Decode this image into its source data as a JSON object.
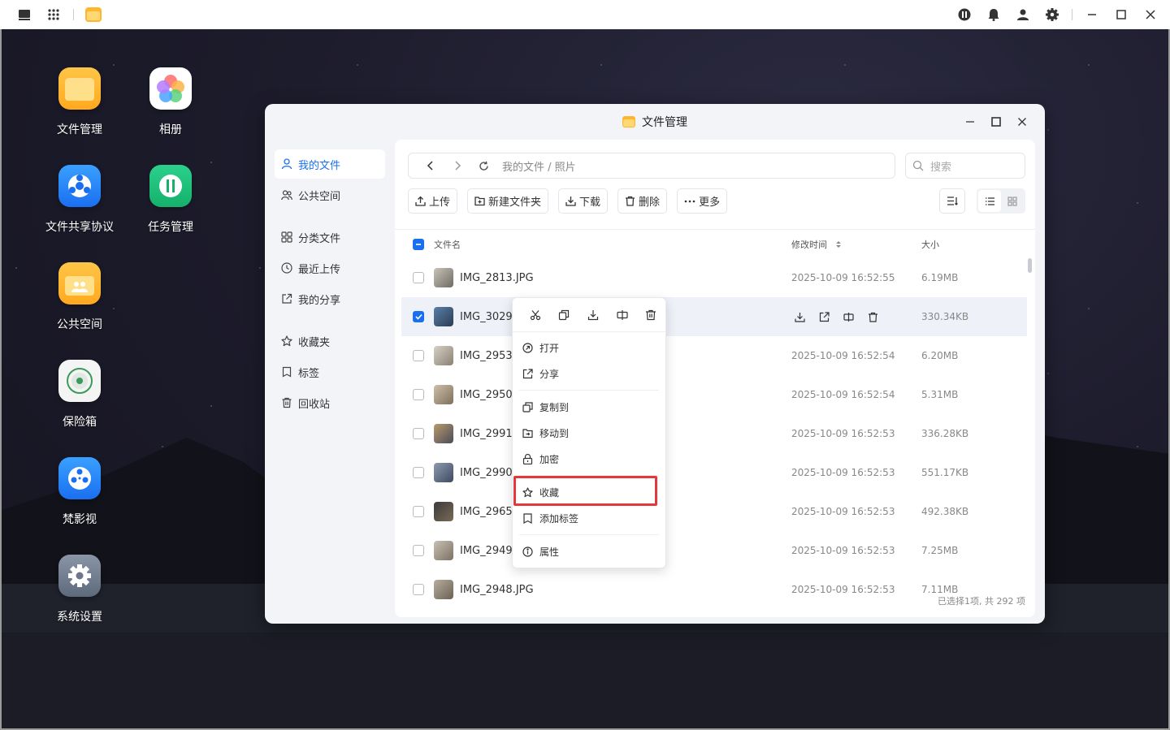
{
  "desktop": {
    "apps": [
      {
        "name": "file-manager",
        "label": "文件管理"
      },
      {
        "name": "photos",
        "label": "相册"
      },
      {
        "name": "file-sharing-protocol",
        "label": "文件共享协议"
      },
      {
        "name": "task-manager",
        "label": "任务管理"
      },
      {
        "name": "public-space",
        "label": "公共空间"
      },
      {
        "name": "safe-box",
        "label": "保险箱"
      },
      {
        "name": "video",
        "label": "梵影视"
      },
      {
        "name": "system-settings",
        "label": "系统设置"
      }
    ]
  },
  "window": {
    "title": "文件管理",
    "sidebar": {
      "items": [
        {
          "label": "我的文件",
          "icon": "person-icon",
          "active": true
        },
        {
          "label": "公共空间",
          "icon": "people-icon"
        },
        {
          "label": "分类文件",
          "icon": "grid-icon"
        },
        {
          "label": "最近上传",
          "icon": "clock-icon"
        },
        {
          "label": "我的分享",
          "icon": "share-icon"
        },
        {
          "label": "收藏夹",
          "icon": "star-icon"
        },
        {
          "label": "标签",
          "icon": "tag-icon"
        },
        {
          "label": "回收站",
          "icon": "trash-icon"
        }
      ]
    },
    "address": {
      "path": "我的文件 / 照片"
    },
    "search": {
      "placeholder": "搜索"
    },
    "toolbar": {
      "upload": "上传",
      "new_folder": "新建文件夹",
      "download": "下载",
      "delete": "删除",
      "more": "更多"
    },
    "table": {
      "col_name": "文件名",
      "col_time": "修改时间",
      "col_size": "大小",
      "rows": [
        {
          "name": "IMG_2813.JPG",
          "time": "2025-10-09 16:52:55",
          "size": "6.19MB",
          "checked": false
        },
        {
          "name": "IMG_3029.",
          "time": "",
          "size": "330.34KB",
          "checked": true
        },
        {
          "name": "IMG_2953.",
          "time": "2025-10-09 16:52:54",
          "size": "6.20MB",
          "checked": false
        },
        {
          "name": "IMG_2950.",
          "time": "2025-10-09 16:52:54",
          "size": "5.31MB",
          "checked": false
        },
        {
          "name": "IMG_2991.",
          "time": "2025-10-09 16:52:53",
          "size": "336.28KB",
          "checked": false
        },
        {
          "name": "IMG_2990.",
          "time": "2025-10-09 16:52:53",
          "size": "551.17KB",
          "checked": false
        },
        {
          "name": "IMG_2965.",
          "time": "2025-10-09 16:52:53",
          "size": "492.38KB",
          "checked": false
        },
        {
          "name": "IMG_2949.",
          "time": "2025-10-09 16:52:53",
          "size": "7.25MB",
          "checked": false
        },
        {
          "name": "IMG_2948.JPG",
          "time": "2025-10-09 16:52:53",
          "size": "7.11MB",
          "checked": false
        }
      ]
    },
    "footer": "已选择1项,  共 292 项"
  },
  "context_menu": {
    "items": [
      {
        "label": "打开",
        "icon": "open-icon"
      },
      {
        "label": "分享",
        "icon": "share-icon"
      },
      {
        "label": "复制到",
        "icon": "copy-to-icon"
      },
      {
        "label": "移动到",
        "icon": "move-to-icon"
      },
      {
        "label": "加密",
        "icon": "lock-icon"
      },
      {
        "label": "收藏",
        "icon": "star-icon"
      },
      {
        "label": "添加标签",
        "icon": "tag-icon"
      },
      {
        "label": "属性",
        "icon": "info-icon"
      }
    ],
    "highlighted": "收藏"
  },
  "colors": {
    "accent": "#1a6ff0",
    "highlight": "#e5383b"
  }
}
